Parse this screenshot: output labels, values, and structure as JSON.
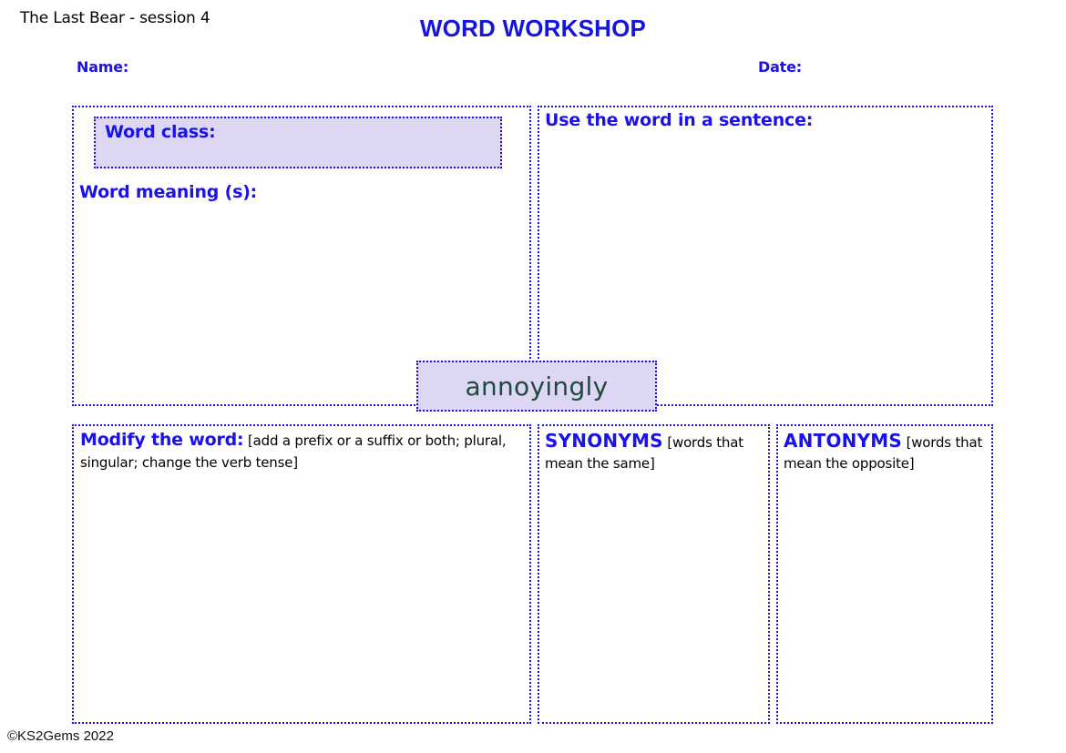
{
  "header": {
    "session_label": "The Last Bear - session 4",
    "title": "WORD WORKSHOP",
    "name_label": "Name:",
    "date_label": "Date:"
  },
  "focus_word": "annoyingly",
  "panels": {
    "word_class_label": "Word class:",
    "word_meaning_label": "Word meaning (s):",
    "sentence_label": "Use the word in a sentence:",
    "modify": {
      "heading": "Modify the word:",
      "note": "[add a prefix or a suffix or both; plural, singular; change the verb tense]"
    },
    "synonyms": {
      "heading": "SYNONYMS",
      "note": "[words that mean the same]"
    },
    "antonyms": {
      "heading": "ANTONYMS",
      "note": "[words that mean the opposite]"
    }
  },
  "footer": {
    "credit": "©KS2Gems 2022"
  },
  "colors": {
    "accent_blue": "#1a12e8",
    "chip_fill": "#ddd7f3",
    "word_text": "#1f4a3f",
    "body_text": "#000000"
  }
}
